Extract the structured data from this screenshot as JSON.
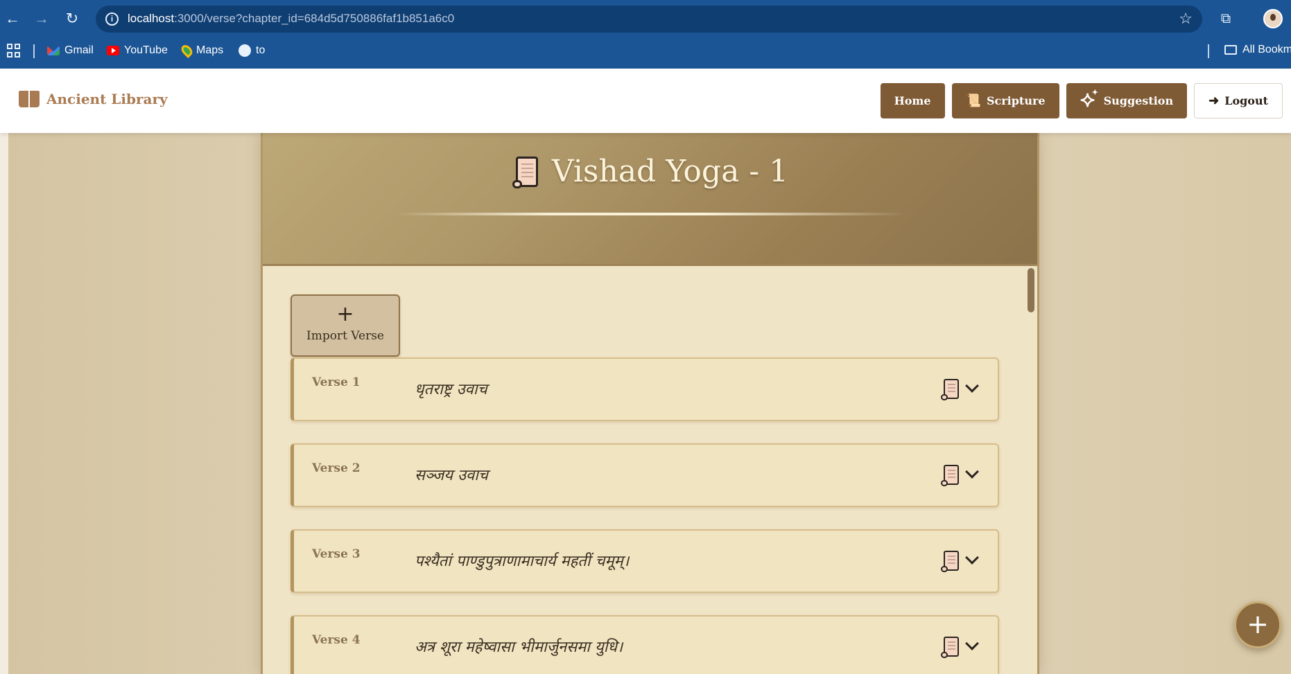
{
  "browser": {
    "url_host": "localhost",
    "url_rest": ":3000/verse?chapter_id=684d5d750886faf1b851a6c0",
    "bookmarks": [
      {
        "label": "Gmail",
        "icon": "gmail-icon"
      },
      {
        "label": "YouTube",
        "icon": "youtube-icon"
      },
      {
        "label": "Maps",
        "icon": "maps-icon"
      },
      {
        "label": "to",
        "icon": "globe-icon"
      }
    ],
    "all_bookmarks": "All Bookm"
  },
  "header": {
    "brand": "Ancient Library",
    "nav": {
      "home": "Home",
      "scripture": "Scripture",
      "suggestion": "Suggestion",
      "logout": "Logout"
    }
  },
  "chapter": {
    "title": "Vishad Yoga - 1"
  },
  "actions": {
    "import_plus": "+",
    "import_label": "Import Verse",
    "fab": "+"
  },
  "verses": [
    {
      "label": "Verse 1",
      "text": "धृतराष्ट्र उवाच"
    },
    {
      "label": "Verse 2",
      "text": "सञ्जय उवाच"
    },
    {
      "label": "Verse 3",
      "text": "पश्यैतां पाण्डुपुत्राणामाचार्य महतीं चमूम्।"
    },
    {
      "label": "Verse 4",
      "text": "अत्र शूरा महेष्वासा भीमार्जुनसमा युधि।"
    }
  ],
  "colors": {
    "browser_bar": "#1b5595",
    "brand": "#a97b52",
    "nav_button": "#7e5a35",
    "panel": "#f0e4c6",
    "header_gradient_start": "#bda878",
    "header_gradient_end": "#8c734b"
  }
}
